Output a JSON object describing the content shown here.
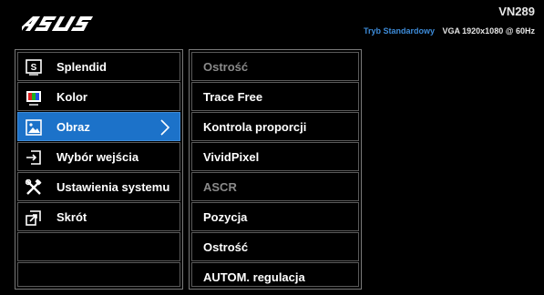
{
  "header": {
    "brand": "ASUS",
    "model": "VN289",
    "mode": "Tryb Standardowy",
    "signal": "VGA  1920x1080 @ 60Hz"
  },
  "colors": {
    "accent": "#1c72c9",
    "mode_text": "#3d8bd8",
    "disabled_text": "#8a8a8a"
  },
  "menu": {
    "items": [
      {
        "label": "Splendid",
        "icon": "splendid-icon"
      },
      {
        "label": "Kolor",
        "icon": "color-icon"
      },
      {
        "label": "Obraz",
        "icon": "image-icon",
        "selected": true
      },
      {
        "label": "Wybór wejścia",
        "icon": "input-select-icon"
      },
      {
        "label": "Ustawienia systemu",
        "icon": "system-settings-icon"
      },
      {
        "label": "Skrót",
        "icon": "shortcut-icon"
      }
    ]
  },
  "submenu": {
    "items": [
      {
        "label": "Ostrość",
        "disabled": true
      },
      {
        "label": "Trace Free"
      },
      {
        "label": "Kontrola proporcji"
      },
      {
        "label": "VividPixel"
      },
      {
        "label": "ASCR",
        "disabled": true
      },
      {
        "label": "Pozycja"
      },
      {
        "label": "Ostrość"
      },
      {
        "label": "AUTOM. regulacja"
      }
    ]
  }
}
